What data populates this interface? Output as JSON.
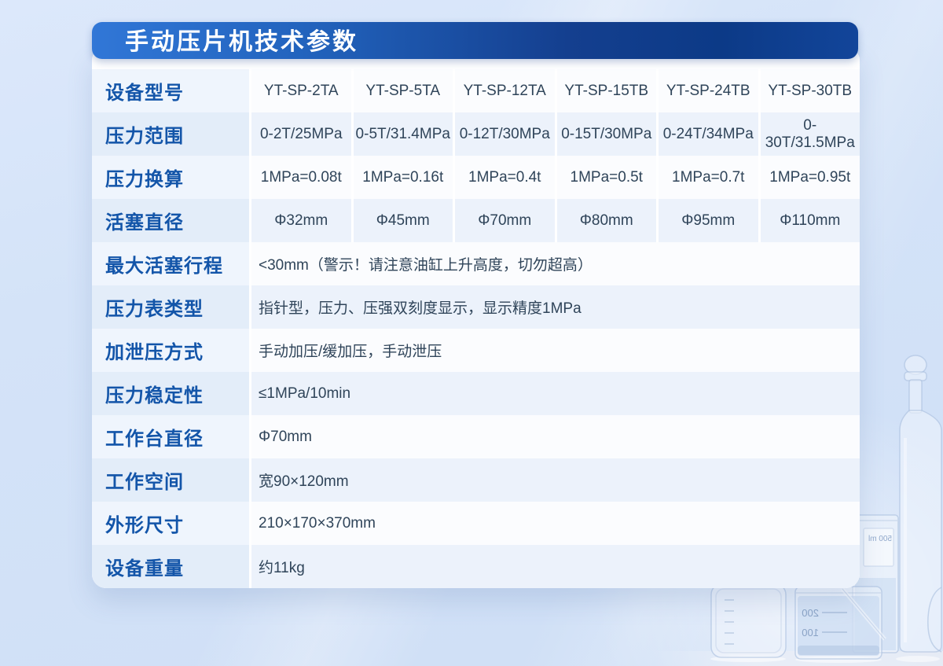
{
  "header": {
    "title": "手动压片机技术参数"
  },
  "colors": {
    "banner_gradient_left": "#3177d7",
    "banner_gradient_right": "#0c3a87",
    "label_blue": "#1355a9",
    "value_dark": "#2f4459",
    "page_background": "#d4e3f8",
    "tinted_row": "#ecf2fb"
  },
  "table": {
    "rows": [
      {
        "label": "设备型号",
        "values": [
          "YT-SP-2TA",
          "YT-SP-5TA",
          "YT-SP-12TA",
          "YT-SP-15TB",
          "YT-SP-24TB",
          "YT-SP-30TB"
        ]
      },
      {
        "label": "压力范围",
        "values": [
          "0-2T/25MPa",
          "0-5T/31.4MPa",
          "0-12T/30MPa",
          "0-15T/30MPa",
          "0-24T/34MPa",
          "0-30T/31.5MPa"
        ]
      },
      {
        "label": "压力换算",
        "values": [
          "1MPa=0.08t",
          "1MPa=0.16t",
          "1MPa=0.4t",
          "1MPa=0.5t",
          "1MPa=0.7t",
          "1MPa=0.95t"
        ]
      },
      {
        "label": "活塞直径",
        "values": [
          "Φ32mm",
          "Φ45mm",
          "Φ70mm",
          "Φ80mm",
          "Φ95mm",
          "Φ110mm"
        ]
      },
      {
        "label": "最大活塞行程",
        "value": "<30mm（警示！请注意油缸上升高度，切勿超高）"
      },
      {
        "label": "压力表类型",
        "value": "指针型，压力、压强双刻度显示，显示精度1MPa"
      },
      {
        "label": "加泄压方式",
        "value": "手动加压/缓加压，手动泄压"
      },
      {
        "label": "压力稳定性",
        "value": "≤1MPa/10min"
      },
      {
        "label": "工作台直径",
        "value": "Φ70mm"
      },
      {
        "label": "工作空间",
        "value": "宽90×120mm"
      },
      {
        "label": "外形尺寸",
        "value": "210×170×370mm"
      },
      {
        "label": "设备重量",
        "value": "约11kg"
      }
    ]
  },
  "background_art": {
    "description": "laboratory glassware photo, light blue tint",
    "beaker_markings": [
      "500 ml",
      "200",
      "100"
    ]
  }
}
